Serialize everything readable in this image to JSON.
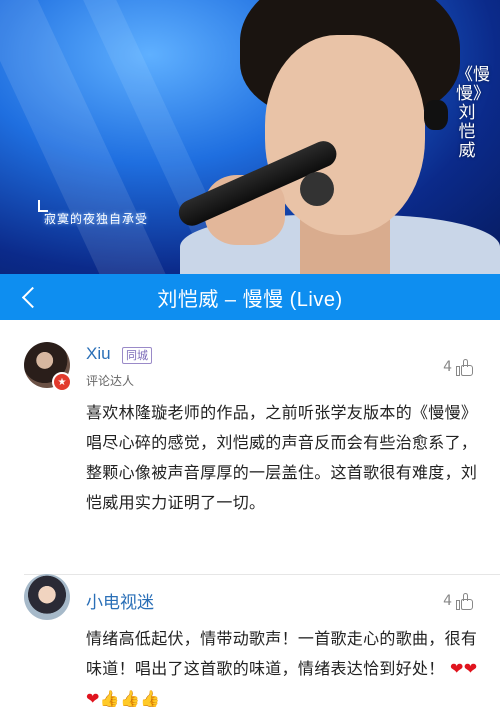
{
  "video": {
    "vertical_title": "《慢慢》刘恺威",
    "lyric_subtitle": "寂寞的夜独自承受"
  },
  "navbar": {
    "title": "刘恺威 – 慢慢 (Live)",
    "back_icon": "chevron-left-icon",
    "color": "#0e8ef0"
  },
  "comments": [
    {
      "username": "Xiu",
      "tag": "同城",
      "role": "评论达人",
      "likes": "4",
      "text": "喜欢林隆璇老师的作品，之前听张学友版本的《慢慢》唱尽心碎的感觉，刘恺威的声音反而会有些治愈系了，整颗心像被声音厚厚的一层盖住。这首歌很有难度，刘恺威用实力证明了一切。"
    },
    {
      "username": "小电视迷",
      "likes": "4",
      "text": "情绪高低起伏，情带动歌声！一首歌走心的歌曲，很有味道！唱出了这首歌的味道，情绪表达恰到好处！",
      "emoji_hearts": "❤❤❤",
      "emoji_thumbs": "👍👍👍"
    }
  ]
}
